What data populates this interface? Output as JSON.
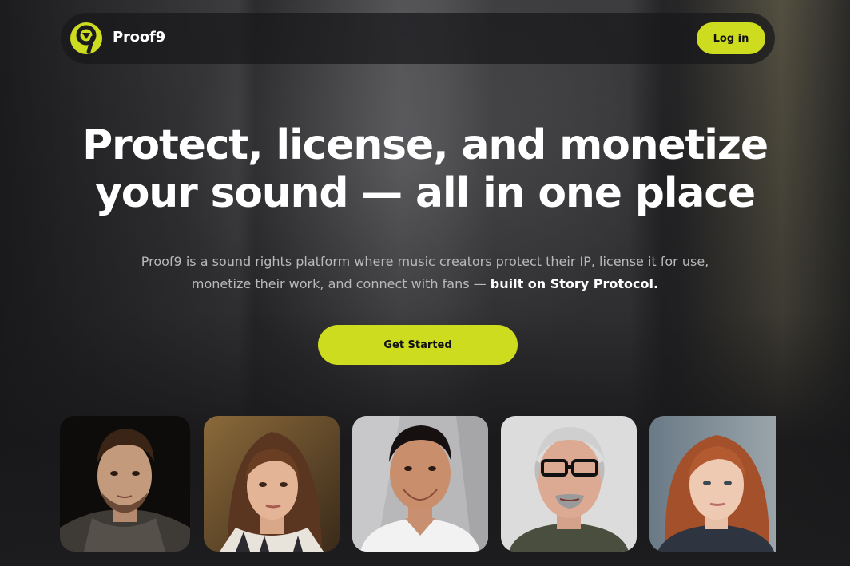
{
  "nav": {
    "brand": "Proof9",
    "login_label": "Log in"
  },
  "hero": {
    "title_line1": "Protect, license, and monetize",
    "title_line2": "your sound — all in one place",
    "subtitle_plain": "Proof9 is a sound rights platform where music creators protect their IP, license it for use, monetize their work, and connect with fans — ",
    "subtitle_bold": "built on Story Protocol.",
    "cta_label": "Get Started"
  },
  "colors": {
    "accent": "#cddc1f",
    "background": "#1c1c1e",
    "text_primary": "#ffffff",
    "text_secondary": "#b9b9bb"
  },
  "icons": {
    "logo": "proof9-logo-icon"
  },
  "portraits": [
    {
      "name": "portrait-1"
    },
    {
      "name": "portrait-2"
    },
    {
      "name": "portrait-3"
    },
    {
      "name": "portrait-4"
    },
    {
      "name": "portrait-5"
    }
  ]
}
